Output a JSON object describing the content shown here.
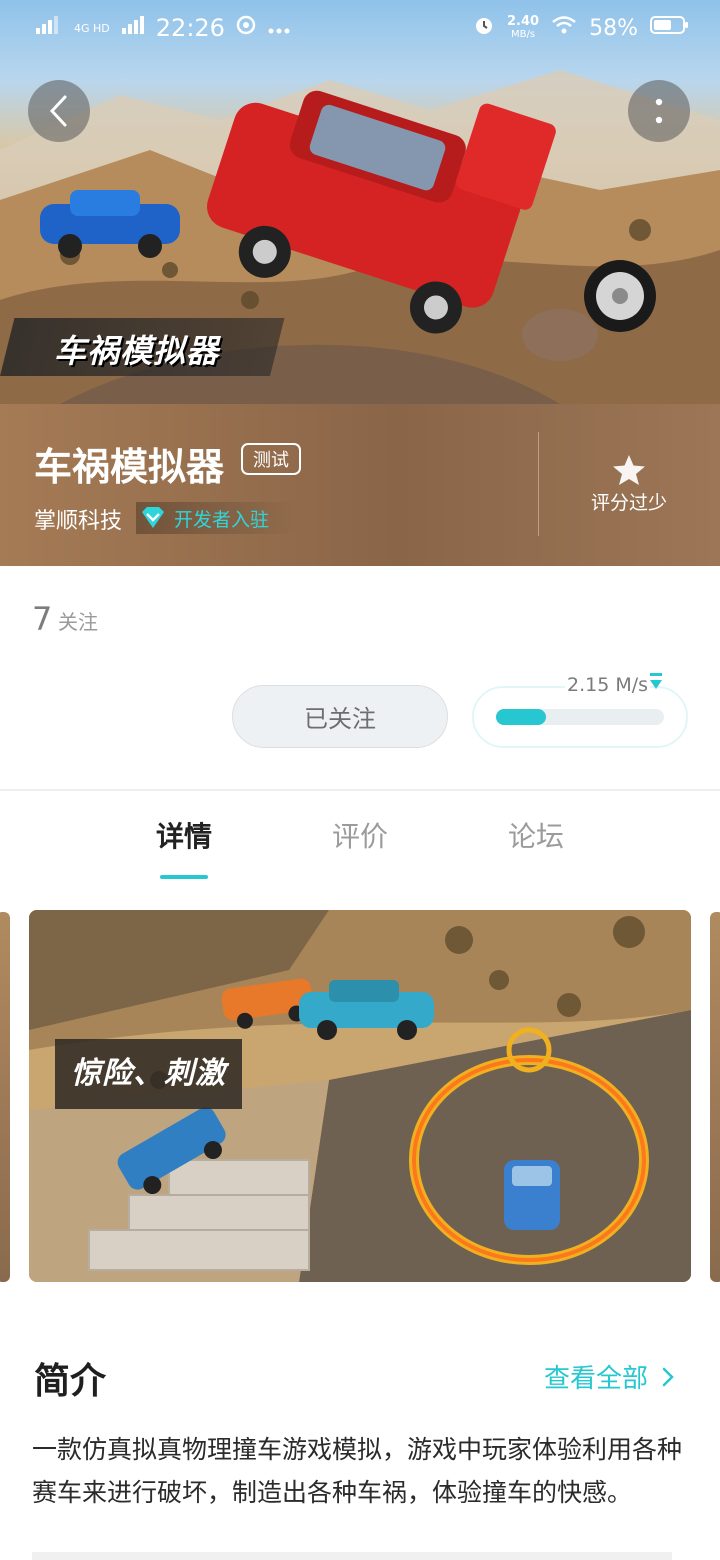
{
  "status_bar": {
    "time": "22:26",
    "net_left": "4G",
    "net_hd": "HD",
    "speed_value": "2.40",
    "speed_unit": "MB/s",
    "battery": "58%"
  },
  "hero": {
    "logo_text": "车祸模拟器",
    "back_icon": "chevron-left-icon",
    "more_icon": "more-vertical-icon"
  },
  "game": {
    "title": "车祸模拟器",
    "badge": "测试",
    "developer": "掌顺科技",
    "developer_tag": "开发者入驻",
    "rating_text": "评分过少"
  },
  "follow": {
    "count": "7",
    "label": "关注",
    "button_label": "已关注"
  },
  "download": {
    "speed": "2.15 M/s",
    "progress": 0.3,
    "accent_color": "#27c7d2"
  },
  "tabs": [
    {
      "label": "详情",
      "active": true
    },
    {
      "label": "评价",
      "active": false
    },
    {
      "label": "论坛",
      "active": false
    }
  ],
  "screenshots": {
    "caption": "惊险、刺激"
  },
  "intro": {
    "title": "简介",
    "more_label": "查看全部",
    "text": "一款仿真拟真物理撞车游戏模拟，游戏中玩家体验利用各种赛车来进行破坏，制造出各种车祸，体验撞车的快感。"
  }
}
